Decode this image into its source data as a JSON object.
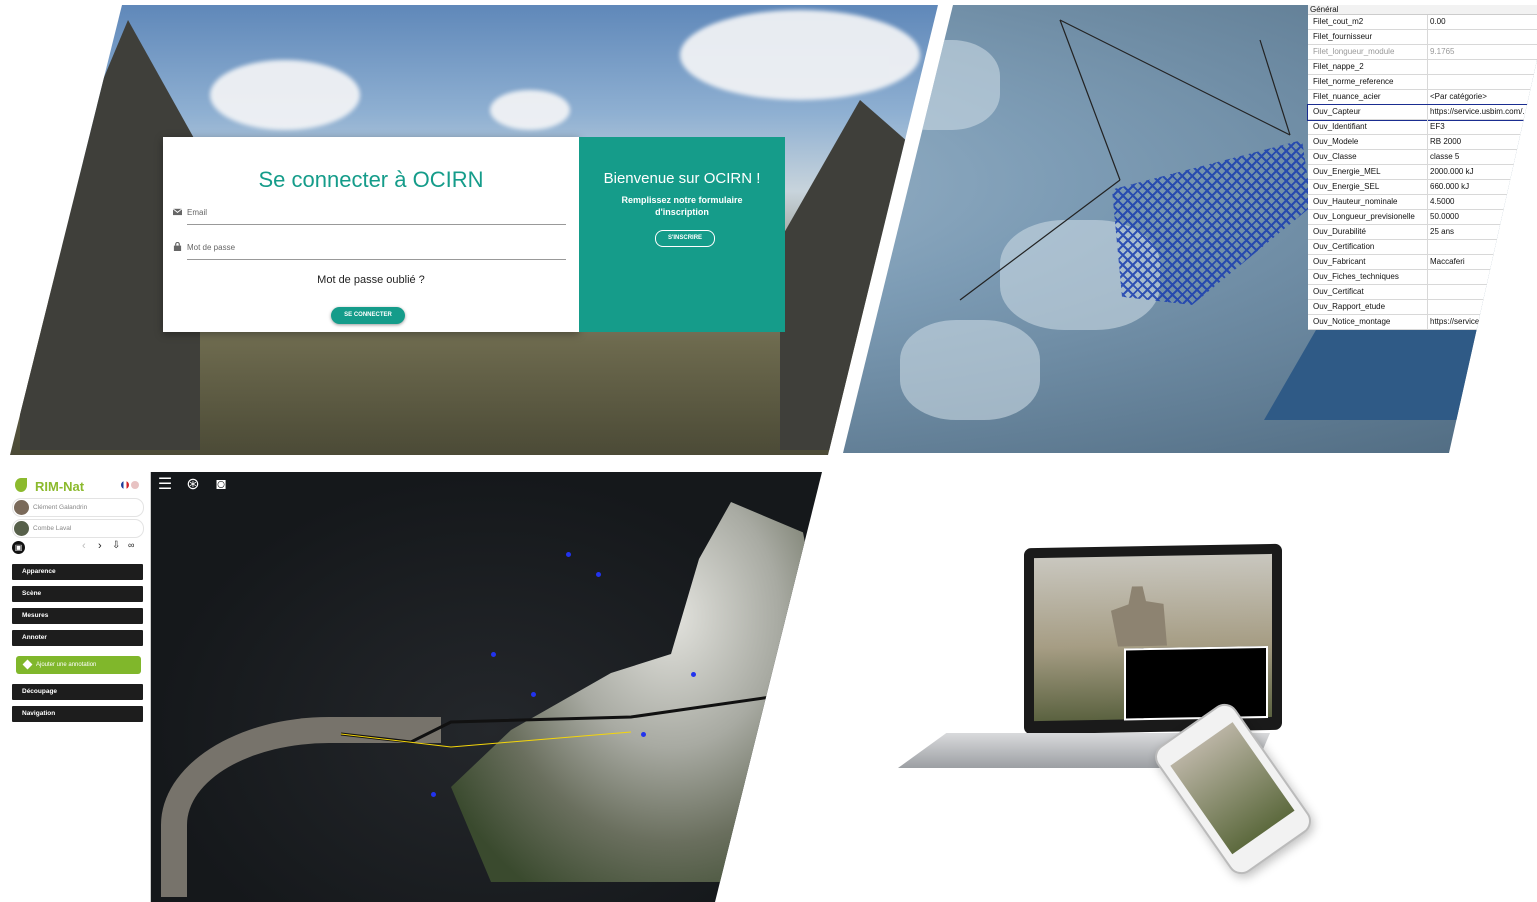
{
  "login": {
    "title": "Se connecter à OCIRN",
    "email_placeholder": "Email",
    "password_placeholder": "Mot de passe",
    "forgot": "Mot de passe oublié ?",
    "login_button": "SE CONNECTER",
    "welcome_title": "Bienvenue sur OCIRN !",
    "welcome_sub": "Remplissez notre formulaire d'inscription",
    "signup_button": "S'INSCRIRE"
  },
  "properties": {
    "header": "Général",
    "rows": [
      {
        "key": "Filet_cout_m2",
        "value": "0.00",
        "style": "normal"
      },
      {
        "key": "Filet_fournisseur",
        "value": "",
        "style": "normal"
      },
      {
        "key": "Filet_longueur_module",
        "value": "9.1765",
        "style": "grey"
      },
      {
        "key": "Filet_nappe_2",
        "value": "",
        "style": "normal"
      },
      {
        "key": "Filet_norme_reference",
        "value": "",
        "style": "normal"
      },
      {
        "key": "Filet_nuance_acier",
        "value": "<Par catégorie>",
        "style": "normal"
      },
      {
        "key": "Ouv_Capteur",
        "value": "https://service.usbim.com/...",
        "style": "highlight"
      },
      {
        "key": "Ouv_Identifiant",
        "value": "EF3",
        "style": "normal"
      },
      {
        "key": "Ouv_Modele",
        "value": "RB 2000",
        "style": "normal"
      },
      {
        "key": "Ouv_Classe",
        "value": "classe 5",
        "style": "normal"
      },
      {
        "key": "Ouv_Energie_MEL",
        "value": "2000.000 kJ",
        "style": "normal"
      },
      {
        "key": "Ouv_Energie_SEL",
        "value": "660.000 kJ",
        "style": "normal"
      },
      {
        "key": "Ouv_Hauteur_nominale",
        "value": "4.5000",
        "style": "normal"
      },
      {
        "key": "Ouv_Longueur_previsionelle",
        "value": "50.0000",
        "style": "normal"
      },
      {
        "key": "Ouv_Durabilité",
        "value": "25 ans",
        "style": "normal"
      },
      {
        "key": "Ouv_Certification",
        "value": "",
        "style": "normal"
      },
      {
        "key": "Ouv_Fabricant",
        "value": "Maccaferi",
        "style": "normal"
      },
      {
        "key": "Ouv_Fiches_techniques",
        "value": "",
        "style": "normal"
      },
      {
        "key": "Ouv_Certificat",
        "value": "",
        "style": "normal"
      },
      {
        "key": "Ouv_Rapport_etude",
        "value": "",
        "style": "normal"
      },
      {
        "key": "Ouv_Notice_montage",
        "value": "https://service.",
        "style": "normal"
      }
    ]
  },
  "rimnat": {
    "brand": "RIM-Nat",
    "user": "Clément Galandrin",
    "site": "Combe Laval",
    "menu": [
      "Apparence",
      "Scène",
      "Mesures",
      "Annoter"
    ],
    "annotation_button": "Ajouter une annotation",
    "menu2": [
      "Découpage",
      "Navigation"
    ]
  },
  "icons": {
    "menu": "hamburger-icon",
    "pin": "map-pin-icon",
    "camera": "camera-icon",
    "save": "save-icon",
    "back": "chevron-left-icon",
    "forward": "chevron-right-icon",
    "export": "export-icon",
    "link": "link-icon"
  },
  "colors": {
    "ocirn_teal": "#159c8a",
    "rimnat_green": "#80b72b",
    "menu_dark": "#1d1d1d"
  }
}
